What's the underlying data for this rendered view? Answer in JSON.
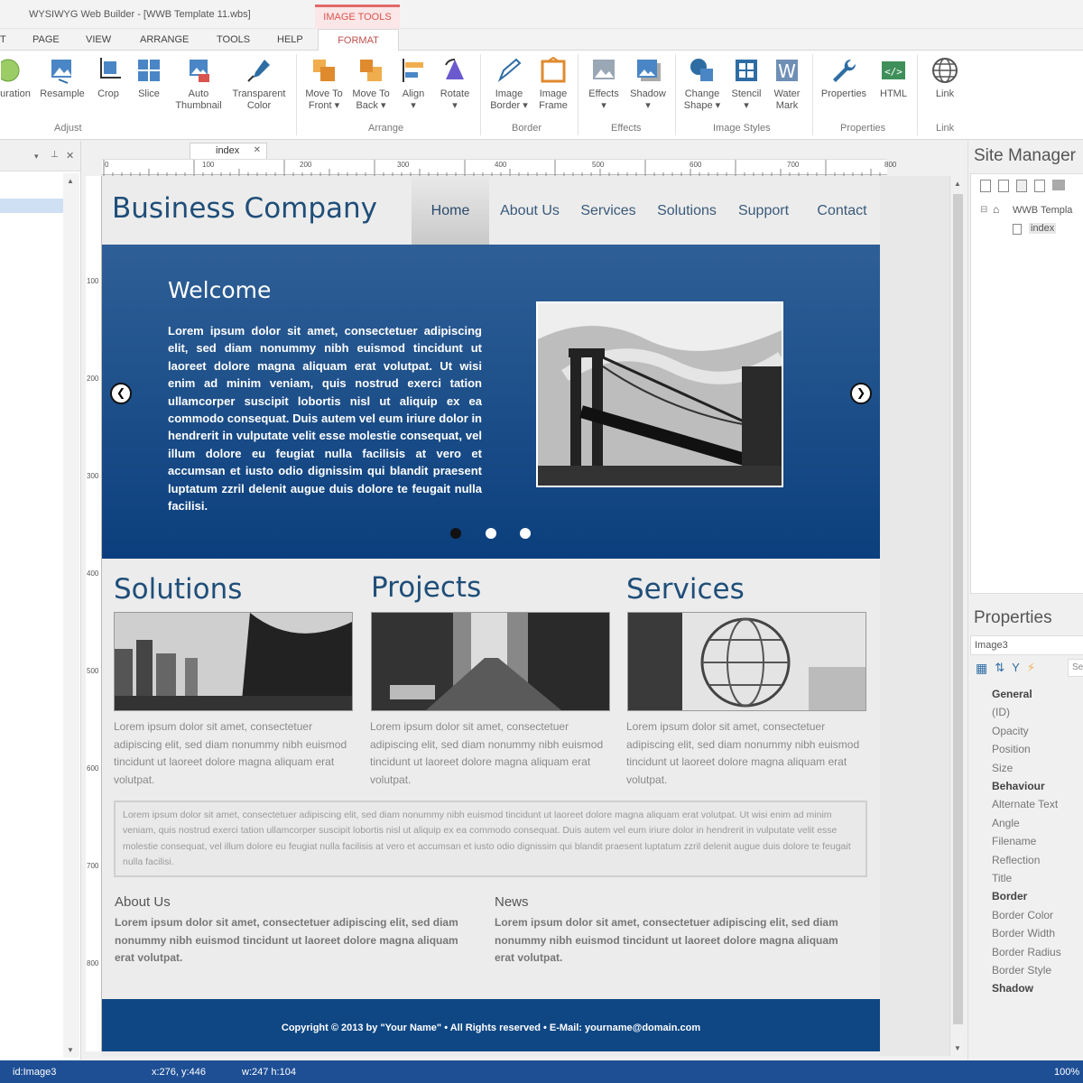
{
  "window": {
    "title": "WYSIWYG Web Builder - [WWB Template 11.wbs]",
    "context_tab": "IMAGE TOOLS"
  },
  "menu": {
    "items": [
      "T",
      "PAGE",
      "VIEW",
      "ARRANGE",
      "TOOLS",
      "HELP"
    ],
    "active": "FORMAT"
  },
  "ribbon": {
    "buttons": [
      {
        "label": "uration",
        "label2": ""
      },
      {
        "label": "Resample",
        "label2": ""
      },
      {
        "label": "Crop",
        "label2": ""
      },
      {
        "label": "Slice",
        "label2": ""
      },
      {
        "label": "Auto",
        "label2": "Thumbnail"
      },
      {
        "label": "Transparent",
        "label2": "Color"
      },
      {
        "label": "Move To",
        "label2": "Front ▾"
      },
      {
        "label": "Move To",
        "label2": "Back ▾"
      },
      {
        "label": "Align",
        "label2": "▾"
      },
      {
        "label": "Rotate",
        "label2": "▾"
      },
      {
        "label": "Image",
        "label2": "Border ▾"
      },
      {
        "label": "Image",
        "label2": "Frame"
      },
      {
        "label": "Effects",
        "label2": "▾"
      },
      {
        "label": "Shadow",
        "label2": "▾"
      },
      {
        "label": "Change",
        "label2": "Shape ▾"
      },
      {
        "label": "Stencil",
        "label2": "▾"
      },
      {
        "label": "Water",
        "label2": "Mark"
      },
      {
        "label": "Properties",
        "label2": ""
      },
      {
        "label": "HTML",
        "label2": ""
      },
      {
        "label": "Link",
        "label2": ""
      }
    ],
    "groups": [
      "Adjust",
      "Arrange",
      "Border",
      "Effects",
      "Image Styles",
      "Properties",
      "Link"
    ]
  },
  "document_tab": "index",
  "ruler": {
    "h": [
      "0",
      "100",
      "200",
      "300",
      "400",
      "500",
      "600",
      "700",
      "800"
    ],
    "v": [
      "100",
      "200",
      "300",
      "400",
      "500",
      "600",
      "700",
      "800"
    ]
  },
  "site": {
    "logo": "Business Company",
    "nav": [
      "Home",
      "About Us",
      "Services",
      "Solutions",
      "Support",
      "Contact"
    ],
    "hero_title": "Welcome",
    "hero_text": "Lorem ipsum dolor sit amet, consectetuer adipiscing elit, sed diam nonummy nibh euismod tincidunt ut laoreet dolore magna aliquam erat volutpat. Ut wisi enim ad minim veniam, quis nostrud exerci tation ullamcorper suscipit lobortis nisl ut aliquip ex ea commodo consequat. Duis autem vel eum iriure dolor in hendrerit in vulputate velit esse molestie consequat, vel illum dolore eu feugiat nulla facilisis at vero et accumsan et iusto odio dignissim qui blandit praesent luptatum zzril delenit augue duis dolore te feugait nulla facilisi.",
    "sections": [
      {
        "title": "Solutions",
        "text": "Lorem ipsum dolor sit amet, consectetuer adipiscing elit, sed diam nonummy nibh euismod tincidunt ut laoreet dolore magna aliquam erat volutpat."
      },
      {
        "title": "Projects",
        "text": "Lorem ipsum dolor sit amet, consectetuer adipiscing elit, sed diam nonummy nibh euismod tincidunt ut laoreet dolore magna aliquam erat volutpat."
      },
      {
        "title": "Services",
        "text": "Lorem ipsum dolor sit amet, consectetuer adipiscing elit, sed diam nonummy nibh euismod tincidunt ut laoreet dolore magna aliquam erat volutpat."
      }
    ],
    "note": "Lorem ipsum dolor sit amet, consectetuer adipiscing elit, sed diam nonummy nibh euismod tincidunt ut laoreet dolore magna aliquam erat volutpat. Ut wisi enim ad minim veniam, quis nostrud exerci tation ullamcorper suscipit lobortis nisl ut aliquip ex ea commodo consequat. Duis autem vel eum iriure dolor in hendrerit in vulputate velit esse molestie consequat, vel illum dolore eu feugiat nulla facilisis at vero et accumsan et iusto odio dignissim qui blandit praesent luptatum zzril delenit augue duis dolore te feugait nulla facilisi.",
    "about_title": "About Us",
    "about_text": "Lorem ipsum dolor sit amet, consectetuer adipiscing elit, sed diam nonummy nibh euismod tincidunt ut laoreet dolore magna aliquam erat volutpat.",
    "news_title": "News",
    "news_text": "Lorem ipsum dolor sit amet, consectetuer adipiscing elit, sed diam nonummy nibh euismod tincidunt ut laoreet dolore magna aliquam erat volutpat.",
    "footer": "Copyright © 2013 by \"Your Name\"  •  All Rights reserved  •  E-Mail: yourname@domain.com"
  },
  "site_manager": {
    "title": "Site Manager",
    "root": "WWB Templa",
    "page": "index"
  },
  "properties": {
    "title": "Properties",
    "object": "Image3",
    "search": "Se",
    "rows": [
      {
        "label": "General",
        "cat": true
      },
      {
        "label": "(ID)",
        "cat": false
      },
      {
        "label": "Opacity",
        "cat": false
      },
      {
        "label": "Position",
        "cat": false
      },
      {
        "label": "Size",
        "cat": false
      },
      {
        "label": "Behaviour",
        "cat": true
      },
      {
        "label": "Alternate Text",
        "cat": false
      },
      {
        "label": "Angle",
        "cat": false
      },
      {
        "label": "Filename",
        "cat": false
      },
      {
        "label": "Reflection",
        "cat": false
      },
      {
        "label": "Title",
        "cat": false
      },
      {
        "label": "Border",
        "cat": true
      },
      {
        "label": "Border Color",
        "cat": false
      },
      {
        "label": "Border Width",
        "cat": false
      },
      {
        "label": "Border Radius",
        "cat": false
      },
      {
        "label": "Border Style",
        "cat": false
      },
      {
        "label": "Shadow",
        "cat": true
      }
    ]
  },
  "status": {
    "id": "id:Image3",
    "pos": "x:276, y:446",
    "size": "w:247 h:104",
    "zoom": "100%"
  },
  "colors": {
    "brand": "#1f4e79",
    "hero": "#0b3f7d",
    "status": "#1e4f95",
    "context": "#d9534f"
  }
}
